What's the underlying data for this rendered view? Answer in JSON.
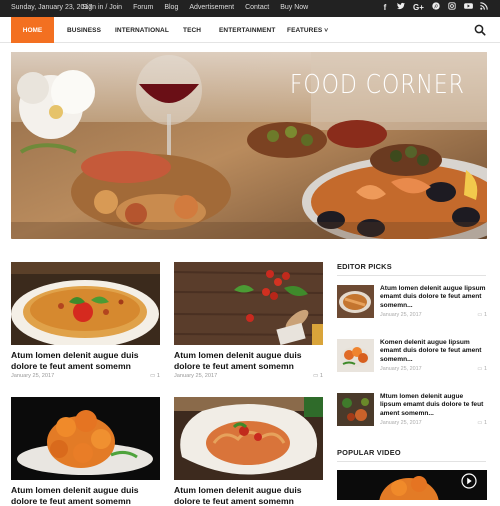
{
  "topbar": {
    "date": "Sunday, January 23, 2017",
    "links": [
      "Sign in / Join",
      "Forum",
      "Blog",
      "Advertisement",
      "Contact",
      "Buy Now"
    ],
    "social_icons": [
      "facebook-icon",
      "twitter-icon",
      "google-plus-icon",
      "pinterest-icon",
      "instagram-icon",
      "youtube-icon",
      "rss-icon"
    ],
    "social_glyphs": [
      "f",
      "t",
      "G+",
      "P",
      "in",
      "▶",
      "rss"
    ]
  },
  "nav": {
    "home": "HOME",
    "items": [
      "BUSINESS",
      "INTERNATIONAL",
      "TECH",
      "ENTERTAINMENT",
      "FEATURES"
    ],
    "features_caret": "˅",
    "accent": "#f37021"
  },
  "hero": {
    "title": "FOOD CORNER"
  },
  "articles": [
    {
      "title": "Atum lomen delenit augue duis dolore te feut ament somemn",
      "date": "January 25, 2017",
      "comments": "1"
    },
    {
      "title": "Atum lomen delenit augue duis dolore te feut ament somemn",
      "date": "January 25, 2017",
      "comments": "1"
    },
    {
      "title": "Atum lomen delenit augue duis dolore te feut ament somemn",
      "date": "",
      "comments": ""
    },
    {
      "title": "Atum lomen delenit augue duis dolore te feut ament somemn",
      "date": "",
      "comments": ""
    }
  ],
  "sidebar": {
    "editor_picks_heading": "EDITOR PICKS",
    "picks": [
      {
        "title": "Atum lomen delenit augue lipsum emamt duis dolore te feut ament somemn...",
        "date": "January 25, 2017",
        "comments": "1"
      },
      {
        "title": "Komen delenit augue lipsum emamt duis dolore te feut ament somemn...",
        "date": "January 25, 2017",
        "comments": "1"
      },
      {
        "title": "Mtum lomen delenit augue lipsum emamt duis dolore te feut ament somemn...",
        "date": "January 25, 2017",
        "comments": "1"
      }
    ],
    "popular_video_heading": "POPULAR VIDEO"
  }
}
